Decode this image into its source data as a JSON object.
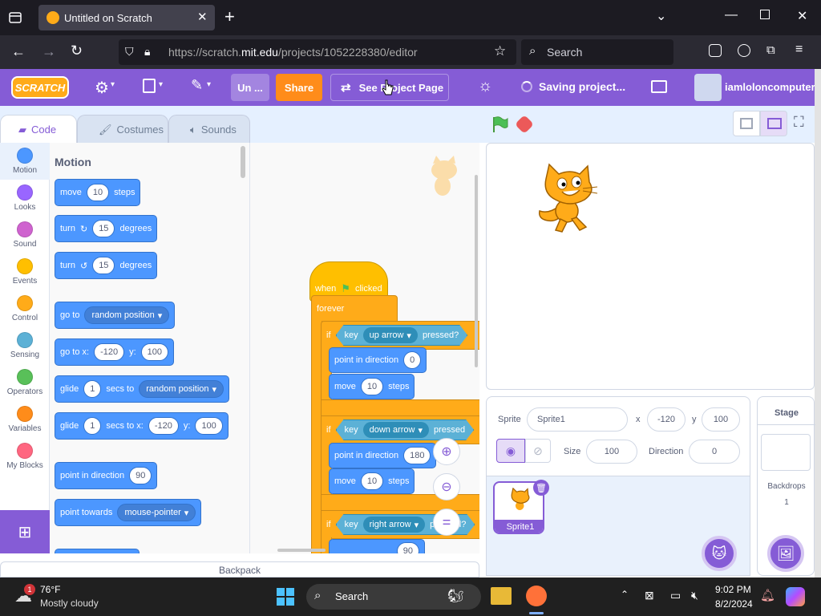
{
  "browser": {
    "tab_title": "Untitled on Scratch",
    "url_prefix": "https://scratch.",
    "url_domain": "mit.edu",
    "url_path": "/projects/1052228380/editor",
    "search_placeholder": "Search"
  },
  "menubar": {
    "logo": "SCRATCH",
    "title_field": "Un ...",
    "share_label": "Share",
    "see_project_page_label": "See Project Page",
    "saving_label": "Saving project...",
    "username": "iamloloncomputer"
  },
  "tabs": {
    "code": "Code",
    "costumes": "Costumes",
    "sounds": "Sounds"
  },
  "categories": [
    {
      "label": "Motion",
      "color": "#4c97ff"
    },
    {
      "label": "Looks",
      "color": "#9966ff"
    },
    {
      "label": "Sound",
      "color": "#cf63cf"
    },
    {
      "label": "Events",
      "color": "#ffbf00"
    },
    {
      "label": "Control",
      "color": "#ffab19"
    },
    {
      "label": "Sensing",
      "color": "#5cb1d6"
    },
    {
      "label": "Operators",
      "color": "#59c059"
    },
    {
      "label": "Variables",
      "color": "#ff8c1a"
    },
    {
      "label": "My Blocks",
      "color": "#ff6680"
    }
  ],
  "palette": {
    "heading": "Motion",
    "move": {
      "a": "move",
      "v": "10",
      "b": "steps"
    },
    "turn_right": {
      "a": "turn",
      "v": "15",
      "b": "degrees"
    },
    "turn_left": {
      "a": "turn",
      "v": "15",
      "b": "degrees"
    },
    "goto": {
      "a": "go to",
      "dd": "random position"
    },
    "goto_xy": {
      "a": "go to x:",
      "x": "-120",
      "b": "y:",
      "y": "100"
    },
    "glide_to": {
      "a": "glide",
      "v": "1",
      "b": "secs to",
      "dd": "random position"
    },
    "glide_xy": {
      "a": "glide",
      "v": "1",
      "b": "secs to x:",
      "x": "-120",
      "c": "y:",
      "y": "100"
    },
    "point_dir": {
      "a": "point in direction",
      "v": "90"
    },
    "point_towards": {
      "a": "point towards",
      "dd": "mouse-pointer"
    }
  },
  "script": {
    "when": "when",
    "clicked": "clicked",
    "forever": "forever",
    "if1": {
      "if": "if",
      "key": "key",
      "dd": "up arrow",
      "pressed": "pressed?"
    },
    "point1": {
      "a": "point in direction",
      "v": "0"
    },
    "move1": {
      "a": "move",
      "v": "10",
      "b": "steps"
    },
    "if2": {
      "if": "if",
      "key": "key",
      "dd": "down arrow",
      "pressed": "pressed"
    },
    "point2": {
      "a": "point in direction",
      "v": "180"
    },
    "move2": {
      "a": "move",
      "v": "10",
      "b": "steps"
    },
    "if3": {
      "if": "if",
      "key": "key",
      "dd": "right arrow",
      "pressed": "pressed?"
    },
    "point3": {
      "v": "90"
    }
  },
  "sprite_info": {
    "sprite_label": "Sprite",
    "sprite_name": "Sprite1",
    "x_label": "x",
    "x_value": "-120",
    "y_label": "y",
    "y_value": "100",
    "size_label": "Size",
    "size_value": "100",
    "direction_label": "Direction",
    "direction_value": "0"
  },
  "sprite_list": [
    {
      "name": "Sprite1"
    }
  ],
  "stage_panel": {
    "title": "Stage",
    "backdrops_label": "Backdrops",
    "backdrops_count": "1"
  },
  "backpack_label": "Backpack",
  "taskbar": {
    "temperature": "76°F",
    "weather": "Mostly cloudy",
    "weather_badge": "1",
    "search_label": "Search",
    "time": "9:02 PM",
    "date": "8/2/2024"
  }
}
